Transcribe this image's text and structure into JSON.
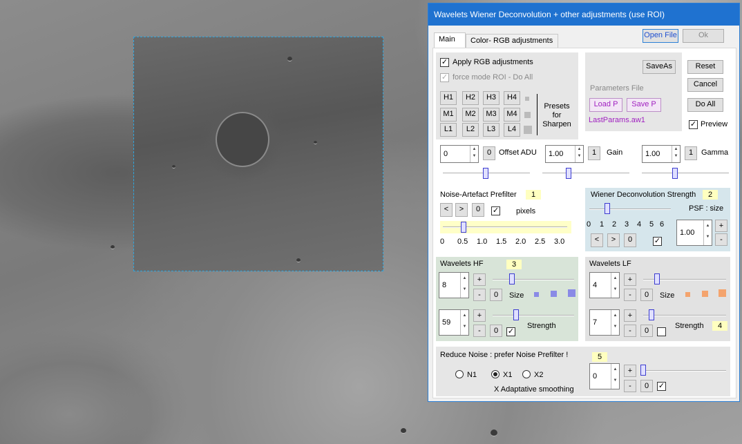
{
  "window": {
    "title": "Wavelets Wiener Deconvolution + other adjustments    (use ROI)"
  },
  "tabs": [
    "Main",
    "Color- RGB adjustments"
  ],
  "buttons": {
    "open_file": "Open File",
    "ok": "Ok",
    "save_as": "SaveAs",
    "reset": "Reset",
    "cancel": "Cancel",
    "do_all": "Do All",
    "load_p": "Load P",
    "save_p": "Save P"
  },
  "rgb": {
    "apply_label": "Apply RGB adjustments",
    "apply_checked": true,
    "force_label": "force mode  ROI - Do All",
    "force_checked": true
  },
  "presets": {
    "row1": [
      "H1",
      "H2",
      "H3",
      "H4"
    ],
    "row2": [
      "M1",
      "M2",
      "M3",
      "M4"
    ],
    "row3": [
      "L1",
      "L2",
      "L3",
      "L4"
    ],
    "label": "Presets for Sharpen"
  },
  "params": {
    "label": "Parameters File",
    "file": "LastParams.aw1",
    "preview_label": "Preview",
    "preview_checked": true
  },
  "offset": {
    "value": "0",
    "reset": "0",
    "label": "Offset ADU"
  },
  "gain": {
    "value": "1.00",
    "reset": "1",
    "label": "Gain"
  },
  "gamma": {
    "value": "1.00",
    "reset": "1",
    "label": "Gamma"
  },
  "prefilter": {
    "title": "Noise-Artefact Prefilter",
    "badge": "1",
    "prev": "<",
    "next": ">",
    "zero": "0",
    "pixels": "pixels",
    "checked": true,
    "ticks": [
      "0",
      "0.5",
      "1.0",
      "1.5",
      "2.0",
      "2.5",
      "3.0"
    ],
    "value": 0.5
  },
  "wiener": {
    "title": "Wiener Deconvolution Strength",
    "badge": "2",
    "psf_label": "PSF : size",
    "ticks": [
      "0",
      "1",
      "2",
      "3",
      "4",
      "5",
      "6"
    ],
    "prev": "<",
    "next": ">",
    "zero": "0",
    "psf_value": "1.00",
    "plus": "+",
    "minus": "-",
    "checked": true,
    "strength": 1
  },
  "hf": {
    "title": "Wavelets HF",
    "badge": "3",
    "size_value": "8",
    "size_label": "Size",
    "strength_value": "59",
    "strength_label": "Strength",
    "plus": "+",
    "minus": "-",
    "zero": "0",
    "checked": true,
    "size_color": "#8a8ae6"
  },
  "lf": {
    "title": "Wavelets LF",
    "badge": "4",
    "size_value": "4",
    "size_label": "Size",
    "strength_value": "7",
    "strength_label": "Strength",
    "plus": "+",
    "minus": "-",
    "zero": "0",
    "checked": false,
    "size_color": "#f4a46e"
  },
  "noise": {
    "title": "Reduce Noise :  prefer Noise Prefilter !",
    "badge": "5",
    "options": [
      "N1",
      "X1",
      "X2"
    ],
    "selected": "X1",
    "note": "X Adaptative smoothing",
    "value": "0",
    "plus": "+",
    "minus": "-",
    "zero": "0",
    "checked": true
  }
}
